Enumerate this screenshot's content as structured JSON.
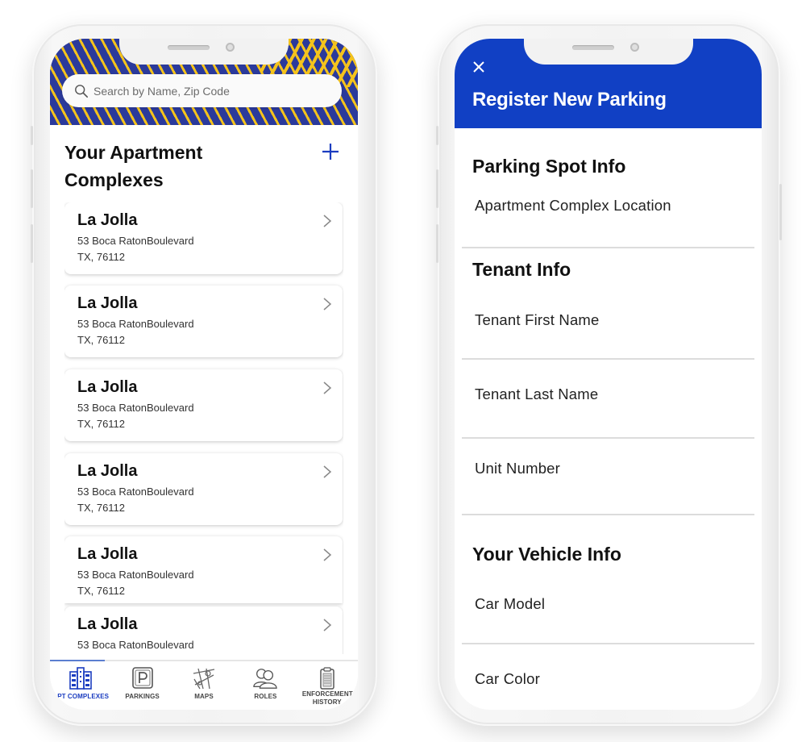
{
  "left_screen": {
    "search": {
      "placeholder": "Search by Name, Zip Code",
      "value": ""
    },
    "title": "Your Apartment Complexes",
    "add_icon": "plus-icon",
    "complexes": [
      {
        "name": "La Jolla",
        "address_line1": "53 Boca RatonBoulevard",
        "address_line2": "TX, 76112"
      },
      {
        "name": "La Jolla",
        "address_line1": "53 Boca RatonBoulevard",
        "address_line2": "TX, 76112"
      },
      {
        "name": "La Jolla",
        "address_line1": "53 Boca RatonBoulevard",
        "address_line2": "TX, 76112"
      },
      {
        "name": "La Jolla",
        "address_line1": "53 Boca RatonBoulevard",
        "address_line2": "TX, 76112"
      },
      {
        "name": "La Jolla",
        "address_line1": "53 Boca RatonBoulevard",
        "address_line2": "TX, 76112"
      },
      {
        "name": "La Jolla",
        "address_line1": "53 Boca RatonBoulevard",
        "address_line2": ""
      }
    ],
    "bottom_nav": [
      {
        "label": "APT COMPLEXES",
        "icon": "buildings-icon",
        "active": true
      },
      {
        "label": "PARKINGS",
        "icon": "parking-icon",
        "active": false
      },
      {
        "label": "MAPS",
        "icon": "map-icon",
        "active": false
      },
      {
        "label": "ROLES",
        "icon": "users-icon",
        "active": false
      },
      {
        "label": "ENFORCEMENT HISTORY",
        "icon": "clipboard-icon",
        "active": false
      }
    ]
  },
  "right_screen": {
    "title": "Register New Parking",
    "close_icon": "close-icon",
    "sections": [
      {
        "title": "Parking Spot Info",
        "fields": [
          "Apartment Complex Location"
        ]
      },
      {
        "title": "Tenant Info",
        "fields": [
          "Tenant First Name",
          "Tenant Last Name",
          "Unit Number"
        ]
      },
      {
        "title": "Your Vehicle Info",
        "fields": [
          "Car Model",
          "Car Color"
        ]
      }
    ]
  },
  "colors": {
    "header_navy": "#2b3a9b",
    "header_stripe_yellow": "#f4c31c",
    "accent_blue": "#1140c4",
    "active_nav": "#1a3cc0"
  }
}
